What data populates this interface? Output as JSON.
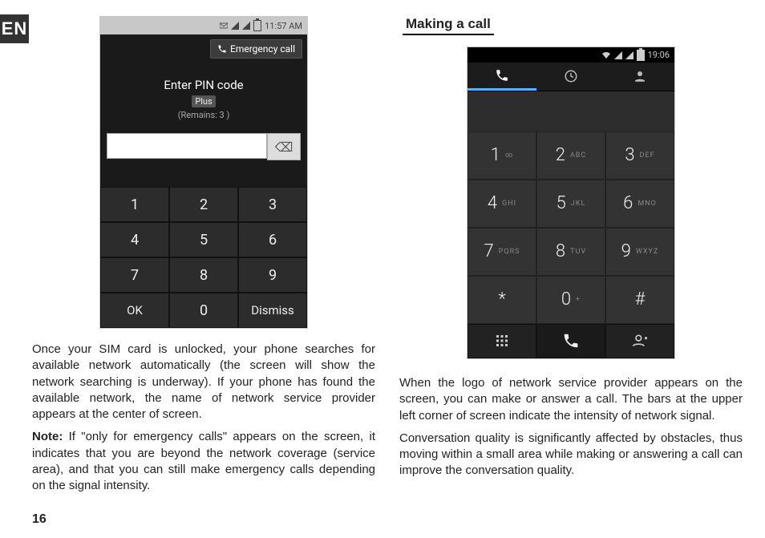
{
  "lang_tab": "EN",
  "page_number": "16",
  "left": {
    "paragraph1": "Once your SIM card is unlocked, your phone searches for available network automatically (the screen will show the network searching is underway). If your phone has found the available network, the name of network service provider appears at the center of screen.",
    "note_label": "Note:",
    "note_text": " If \"only for emergency calls\" appears on the screen, it indicates that you are beyond the network coverage (service area), and that you can still make emergency calls depending on the signal intensity."
  },
  "right": {
    "section_title": "Making a call",
    "paragraph1": "When the logo of network service provider appears on the screen, you can make or answer a call. The bars at the upper left corner of screen indicate the intensity of network signal.",
    "paragraph2": "Conversation quality is significantly affected by obstacles, thus moving within a small area while making or answering a call can improve the conversation quality."
  },
  "pin_phone": {
    "status_time": "11:57 AM",
    "emergency_label": "Emergency call",
    "title": "Enter PIN code",
    "sim_tag": "Plus",
    "remains": "(Remains: 3 )",
    "keys": [
      "1",
      "2",
      "3",
      "4",
      "5",
      "6",
      "7",
      "8",
      "9",
      "OK",
      "0",
      "Dismiss"
    ]
  },
  "dial_phone": {
    "status_time": "19:06",
    "keys": [
      {
        "n": "1",
        "l": "∞"
      },
      {
        "n": "2",
        "l": "ABC"
      },
      {
        "n": "3",
        "l": "DEF"
      },
      {
        "n": "4",
        "l": "GHI"
      },
      {
        "n": "5",
        "l": "JKL"
      },
      {
        "n": "6",
        "l": "MNO"
      },
      {
        "n": "7",
        "l": "PQRS"
      },
      {
        "n": "8",
        "l": "TUV"
      },
      {
        "n": "9",
        "l": "WXYZ"
      },
      {
        "n": "*",
        "l": ""
      },
      {
        "n": "0",
        "l": "+"
      },
      {
        "n": "#",
        "l": ""
      }
    ]
  }
}
